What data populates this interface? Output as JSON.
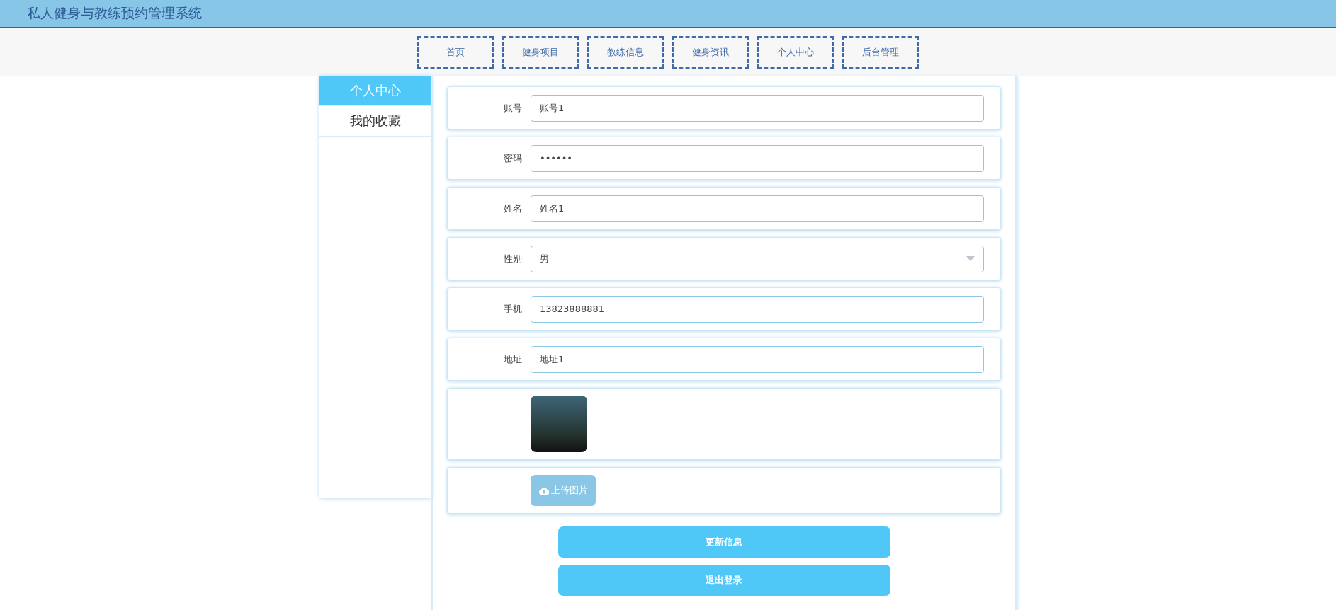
{
  "header": {
    "title": "私人健身与教练预约管理系统"
  },
  "nav": [
    {
      "label": "首页"
    },
    {
      "label": "健身项目"
    },
    {
      "label": "教练信息"
    },
    {
      "label": "健身资讯"
    },
    {
      "label": "个人中心"
    },
    {
      "label": "后台管理"
    }
  ],
  "sidebar": {
    "items": [
      {
        "label": "个人中心",
        "selected": true
      },
      {
        "label": "我的收藏",
        "selected": false
      }
    ]
  },
  "form": {
    "fields": [
      {
        "label": "账号",
        "kind": "text",
        "value": "账号1"
      },
      {
        "label": "密码",
        "kind": "text",
        "value": "••••••"
      },
      {
        "label": "姓名",
        "kind": "text",
        "value": "姓名1"
      },
      {
        "label": "性别",
        "kind": "select",
        "value": "男"
      },
      {
        "label": "手机",
        "kind": "text",
        "value": "13823888881"
      },
      {
        "label": "地址",
        "kind": "text",
        "value": "地址1"
      }
    ],
    "upload_button": "上传图片"
  },
  "buttons": [
    "更新信息",
    "退出登录"
  ]
}
